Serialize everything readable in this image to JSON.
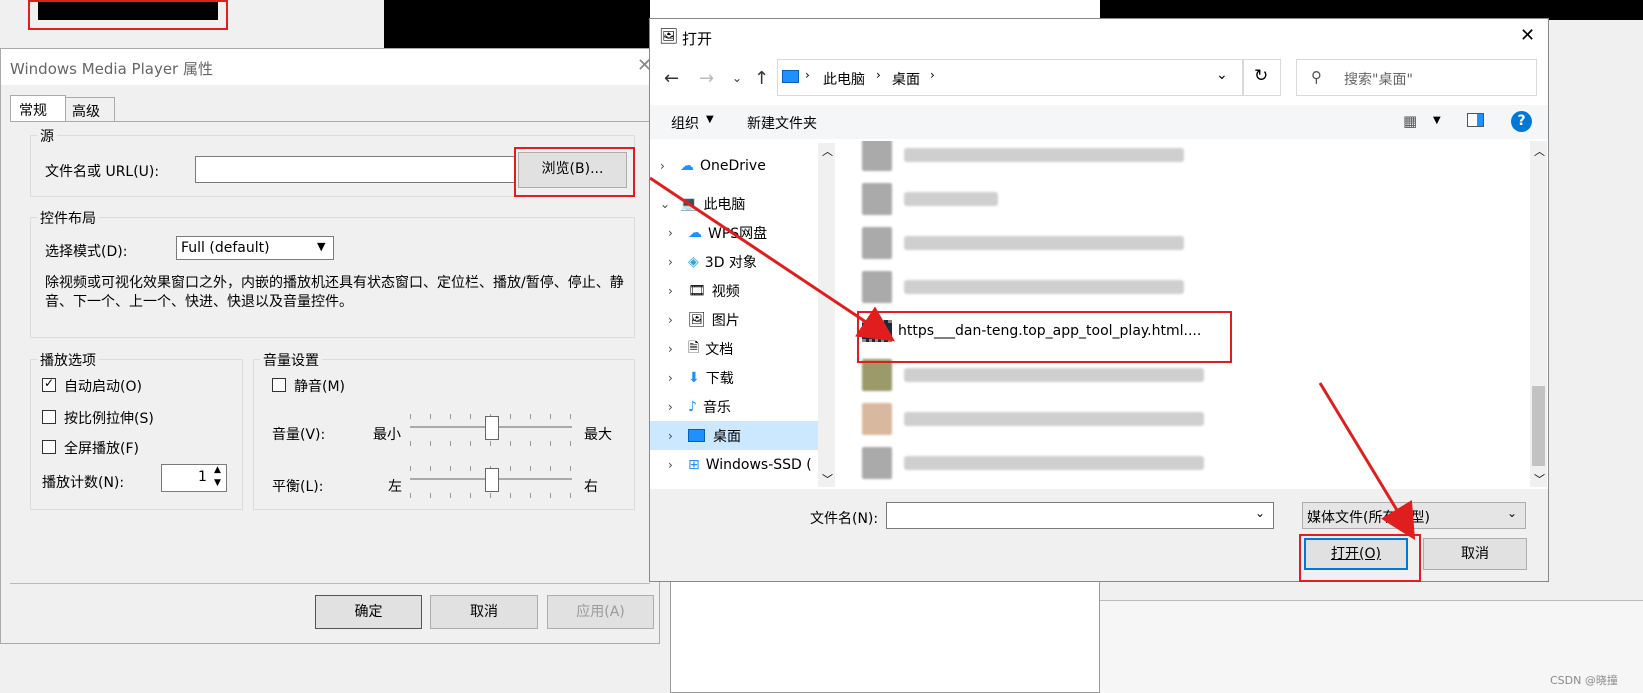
{
  "wmp": {
    "title": "Windows Media Player 属性",
    "tabs": [
      "常规",
      "高级"
    ],
    "source": {
      "group_title": "源",
      "url_label": "文件名或 URL(U):",
      "browse_label": "浏览(B)..."
    },
    "layout": {
      "group_title": "控件布局",
      "mode_label": "选择模式(D):",
      "mode_value": "Full (default)",
      "desc": "除视频或可视化效果窗口之外，内嵌的播放机还具有状态窗口、定位栏、播放/暂停、停止、静音、下一个、上一个、快进、快退以及音量控件。"
    },
    "play_options": {
      "group_title": "播放选项",
      "autostart_label": "自动启动(O)",
      "autostart_checked": true,
      "stretch_label": "按比例拉伸(S)",
      "stretch_checked": false,
      "fullscreen_label": "全屏播放(F)",
      "fullscreen_checked": false,
      "count_label": "播放计数(N):",
      "count_value": "1"
    },
    "volume": {
      "group_title": "音量设置",
      "mute_label": "静音(M)",
      "mute_checked": false,
      "volume_label": "音量(V):",
      "min_label": "最小",
      "max_label": "最大",
      "balance_label": "平衡(L):",
      "left_label": "左",
      "right_label": "右",
      "volume_level": 0.5,
      "balance_level": 0.5
    },
    "buttons": {
      "ok": "确定",
      "cancel": "取消",
      "apply": "应用(A)"
    }
  },
  "open": {
    "title": "打开",
    "breadcrumb": [
      "此电脑",
      "桌面"
    ],
    "search_placeholder": "搜索\"桌面\"",
    "toolbar": {
      "organize": "组织",
      "new_folder": "新建文件夹"
    },
    "tree": [
      {
        "label": "OneDrive",
        "icon": "cloud-icon",
        "expanded": false
      },
      {
        "label": "此电脑",
        "icon": "computer-icon",
        "expanded": true
      },
      {
        "label": "WPS网盘",
        "icon": "cloud-icon",
        "expanded": false
      },
      {
        "label": "3D 对象",
        "icon": "cube-icon",
        "expanded": false
      },
      {
        "label": "视频",
        "icon": "video-icon",
        "expanded": false
      },
      {
        "label": "图片",
        "icon": "picture-icon",
        "expanded": false
      },
      {
        "label": "文档",
        "icon": "document-icon",
        "expanded": false
      },
      {
        "label": "下载",
        "icon": "download-icon",
        "expanded": false
      },
      {
        "label": "音乐",
        "icon": "music-icon",
        "expanded": false
      },
      {
        "label": "桌面",
        "icon": "desktop-icon",
        "expanded": false,
        "selected": true
      },
      {
        "label": "Windows-SSD (",
        "icon": "drive-icon",
        "expanded": false
      }
    ],
    "highlighted_file": "https___dan-teng.top_app_tool_play.html....",
    "filename_label": "文件名(N):",
    "filename_value": "",
    "filetype_value": "媒体文件(所有类型)",
    "buttons": {
      "open": "打开(O)",
      "cancel": "取消"
    }
  },
  "watermark": "CSDN @晓撞",
  "colors": {
    "accent": "#0078d7",
    "annotation_red": "#e01e1e",
    "selected_bg": "#cce8ff"
  }
}
